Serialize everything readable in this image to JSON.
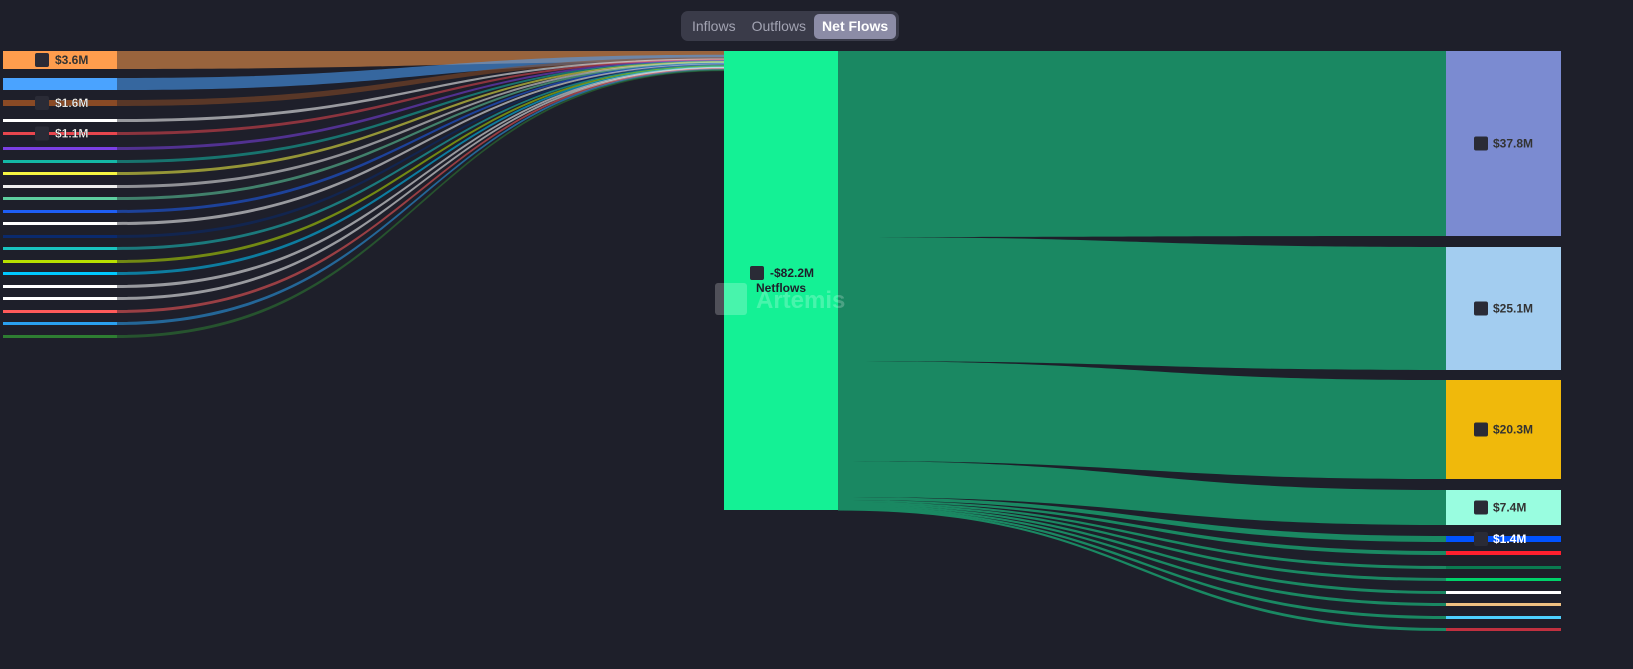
{
  "tabs": [
    {
      "label": "Inflows"
    },
    {
      "label": "Outflows"
    },
    {
      "label": "Net Flows",
      "active": true
    }
  ],
  "watermark": "Artemis",
  "chart_data": {
    "type": "sankey",
    "title": "Net Flows",
    "center": {
      "label": "-$82.2M",
      "name": "Netflows",
      "value": -82.2,
      "color": "#14f195",
      "icon": "solana-icon"
    },
    "sources": [
      {
        "label": "$3.6M",
        "value": 3.6,
        "color": "#ff9d4d",
        "icon": "exchange-icon"
      },
      {
        "label": null,
        "value": 2.4,
        "color": "#4aa3ff"
      },
      {
        "label": "$1.6M",
        "value": 1.6,
        "color": "#8a4a25",
        "icon": "token-icon"
      },
      {
        "label": null,
        "value": 0.8,
        "color": "#ffffff"
      },
      {
        "label": "$1.1M",
        "value": 1.1,
        "color": "#e8464e",
        "icon": "avalanche-icon"
      },
      {
        "label": null,
        "value": 0.6,
        "color": "#7b3fe4"
      },
      {
        "label": null,
        "value": 0.6,
        "color": "#14b8a6"
      },
      {
        "label": null,
        "value": 0.6,
        "color": "#f5f542"
      },
      {
        "label": null,
        "value": 0.6,
        "color": "#eeeeee"
      },
      {
        "label": null,
        "value": 0.6,
        "color": "#5ecfa0"
      },
      {
        "label": null,
        "value": 0.6,
        "color": "#1e5ef5"
      },
      {
        "label": null,
        "value": 0.6,
        "color": "#ffffff"
      },
      {
        "label": null,
        "value": 0.6,
        "color": "#0a2a6e"
      },
      {
        "label": null,
        "value": 0.6,
        "color": "#19c3c0"
      },
      {
        "label": null,
        "value": 0.6,
        "color": "#b8e000"
      },
      {
        "label": null,
        "value": 0.6,
        "color": "#00c8ff"
      },
      {
        "label": null,
        "value": 0.6,
        "color": "#ffffff"
      },
      {
        "label": null,
        "value": 0.6,
        "color": "#ffffff"
      },
      {
        "label": null,
        "value": 0.6,
        "color": "#ff5a5a"
      },
      {
        "label": null,
        "value": 0.6,
        "color": "#2aa0f0"
      },
      {
        "label": null,
        "value": 0.6,
        "color": "#2e7d32"
      }
    ],
    "targets": [
      {
        "label": "$37.8M",
        "value": 37.8,
        "color": "#7b8bd1",
        "icon": "ethereum-icon"
      },
      {
        "label": "$25.1M",
        "value": 25.1,
        "color": "#a3cdf0",
        "icon": "arbitrum-icon"
      },
      {
        "label": "$20.3M",
        "value": 20.3,
        "color": "#f0b90b",
        "icon": "bnb-icon"
      },
      {
        "label": "$7.4M",
        "value": 7.4,
        "color": "#99fde0",
        "icon": "sui-icon"
      },
      {
        "label": "$1.4M",
        "value": 1.4,
        "color": "#0052ff",
        "icon": "base-icon"
      },
      {
        "label": null,
        "value": 0.5,
        "color": "#ff1f2e"
      },
      {
        "label": null,
        "value": 0.3,
        "color": "#0a7a50"
      },
      {
        "label": null,
        "value": 0.3,
        "color": "#00d26a"
      },
      {
        "label": null,
        "value": 0.3,
        "color": "#ffffff"
      },
      {
        "label": null,
        "value": 0.3,
        "color": "#f0c080"
      },
      {
        "label": null,
        "value": 0.3,
        "color": "#4dd0ff"
      },
      {
        "label": null,
        "value": 0.3,
        "color": "#c0303f"
      }
    ],
    "link_color": "#1a8862"
  }
}
